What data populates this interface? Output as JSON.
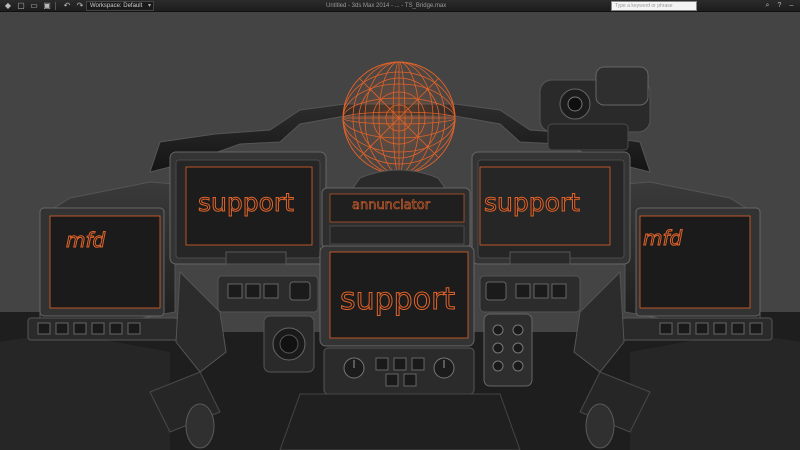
{
  "titlebar": {
    "workspace_label": "Workspace: Default",
    "document_title": "Untitled - 3ds Max 2014 - ... - TS_Bridge.max",
    "search_placeholder": "Type a keyword or phrase"
  },
  "scene": {
    "screens": {
      "support_left": "support",
      "support_right": "support",
      "support_center": "support",
      "annunciator": "annunciator",
      "mfd_left": "mfd",
      "mfd_right": "mfd"
    },
    "colors": {
      "viewport_background": "#444444",
      "wireframe_accent": "#e0632a",
      "panel_body": "#2a2a2a",
      "screen_glass": "#1c1c1c"
    }
  }
}
